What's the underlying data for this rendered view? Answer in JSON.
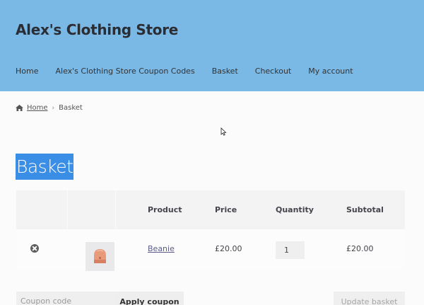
{
  "header": {
    "site_title": "Alex's Clothing Store",
    "nav": [
      "Home",
      "Alex's Clothing Store Coupon Codes",
      "Basket",
      "Checkout",
      "My account"
    ],
    "background_color": "#7ab8e6"
  },
  "breadcrumb": {
    "home": "Home",
    "current": "Basket"
  },
  "page": {
    "title": "Basket",
    "title_highlight_color": "#3a8ee6"
  },
  "cart": {
    "columns": [
      "",
      "",
      "Product",
      "Price",
      "Quantity",
      "Subtotal"
    ],
    "items": [
      {
        "remove_icon": "remove-circle-icon",
        "thumbnail_icon": "beanie-hat-icon",
        "product": "Beanie",
        "price": "£20.00",
        "quantity": "1",
        "subtotal": "£20.00"
      }
    ]
  },
  "actions": {
    "coupon_placeholder": "Coupon code",
    "apply_coupon": "Apply coupon",
    "update_basket": "Update basket"
  }
}
